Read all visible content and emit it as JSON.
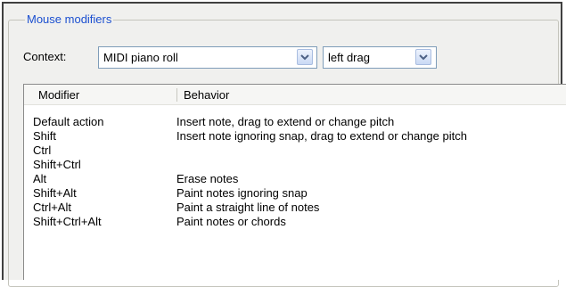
{
  "group": {
    "title": "Mouse modifiers"
  },
  "context": {
    "label": "Context:",
    "primary_value": "MIDI piano roll",
    "secondary_value": "left drag"
  },
  "table": {
    "columns": [
      "Modifier",
      "Behavior"
    ],
    "rows": [
      {
        "modifier": "Default action",
        "behavior": "Insert note, drag to extend or change pitch"
      },
      {
        "modifier": "Shift",
        "behavior": "Insert note ignoring snap, drag to extend or change pitch"
      },
      {
        "modifier": "Ctrl",
        "behavior": ""
      },
      {
        "modifier": "Shift+Ctrl",
        "behavior": ""
      },
      {
        "modifier": "Alt",
        "behavior": "Erase notes"
      },
      {
        "modifier": "Shift+Alt",
        "behavior": "Paint notes ignoring snap"
      },
      {
        "modifier": "Ctrl+Alt",
        "behavior": "Paint a straight line of notes"
      },
      {
        "modifier": "Shift+Ctrl+Alt",
        "behavior": "Paint notes or chords"
      }
    ]
  },
  "icons": {
    "dropdown": "chevron-down-icon"
  },
  "colors": {
    "title_blue": "#1b4fd0",
    "panel_bg": "#f0f0ee",
    "border": "#7f9db9"
  }
}
